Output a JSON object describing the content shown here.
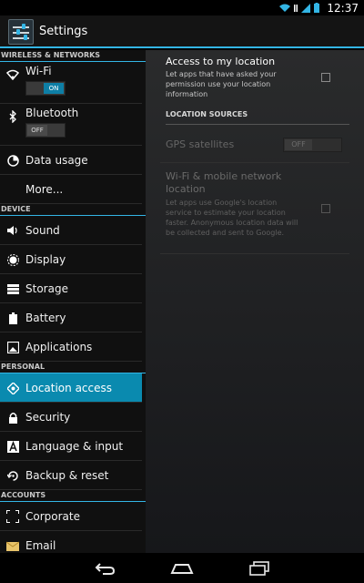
{
  "status": {
    "time": "12:37"
  },
  "actionbar": {
    "title": "Settings"
  },
  "sidebar": {
    "sections": [
      {
        "header": "WIRELESS & NETWORKS"
      },
      {
        "header": "DEVICE"
      },
      {
        "header": "PERSONAL"
      },
      {
        "header": "ACCOUNTS"
      }
    ],
    "items": {
      "wifi": {
        "label": "Wi-Fi",
        "toggle": "ON"
      },
      "bluetooth": {
        "label": "Bluetooth",
        "toggle": "OFF"
      },
      "data_usage": {
        "label": "Data usage"
      },
      "more": {
        "label": "More..."
      },
      "sound": {
        "label": "Sound"
      },
      "display": {
        "label": "Display"
      },
      "storage": {
        "label": "Storage"
      },
      "battery": {
        "label": "Battery"
      },
      "applications": {
        "label": "Applications"
      },
      "location_access": {
        "label": "Location access"
      },
      "security": {
        "label": "Security"
      },
      "language_input": {
        "label": "Language & input"
      },
      "backup_reset": {
        "label": "Backup & reset"
      },
      "corporate": {
        "label": "Corporate"
      },
      "email": {
        "label": "Email"
      }
    }
  },
  "detail": {
    "access_title": "Access to my location",
    "access_desc": "Let apps that have asked your permission use your location information",
    "section_header": "LOCATION SOURCES",
    "gps_label": "GPS satellites",
    "gps_toggle": "OFF",
    "wifi_title": "Wi-Fi & mobile network location",
    "wifi_desc": "Let apps use Google's location service to estimate your location faster. Anonymous location data will be collected and sent to Google."
  },
  "colors": {
    "accent": "#33b5e5",
    "selected": "#0a8aaf"
  }
}
